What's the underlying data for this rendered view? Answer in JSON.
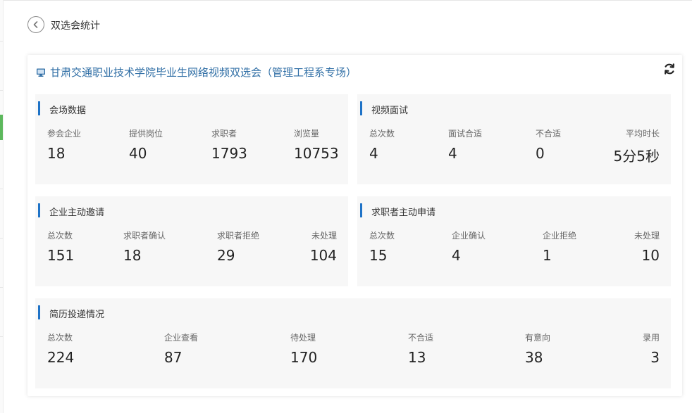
{
  "page": {
    "title": "双选会统计"
  },
  "event": {
    "title": "甘肃交通职业技术学院毕业生网络视频双选会（管理工程系专场）"
  },
  "sections": {
    "venue": {
      "title": "会场数据",
      "stats": [
        {
          "label": "参会企业",
          "value": "18"
        },
        {
          "label": "提供岗位",
          "value": "40"
        },
        {
          "label": "求职者",
          "value": "1793"
        },
        {
          "label": "浏览量",
          "value": "10753"
        }
      ]
    },
    "video": {
      "title": "视频面试",
      "stats": [
        {
          "label": "总次数",
          "value": "4"
        },
        {
          "label": "面试合适",
          "value": "4"
        },
        {
          "label": "不合适",
          "value": "0"
        },
        {
          "label": "平均时长",
          "value": "5分5秒"
        }
      ]
    },
    "invite": {
      "title": "企业主动邀请",
      "stats": [
        {
          "label": "总次数",
          "value": "151"
        },
        {
          "label": "求职者确认",
          "value": "18"
        },
        {
          "label": "求职者拒绝",
          "value": "29"
        },
        {
          "label": "未处理",
          "value": "104"
        }
      ]
    },
    "apply": {
      "title": "求职者主动申请",
      "stats": [
        {
          "label": "总次数",
          "value": "15"
        },
        {
          "label": "企业确认",
          "value": "4"
        },
        {
          "label": "企业拒绝",
          "value": "1"
        },
        {
          "label": "未处理",
          "value": "10"
        }
      ]
    },
    "resume": {
      "title": "简历投递情况",
      "stats": [
        {
          "label": "总次数",
          "value": "224"
        },
        {
          "label": "企业查看",
          "value": "87"
        },
        {
          "label": "待处理",
          "value": "170"
        },
        {
          "label": "不合适",
          "value": "13"
        },
        {
          "label": "有意向",
          "value": "38"
        },
        {
          "label": "录用",
          "value": "3"
        }
      ]
    }
  },
  "colors": {
    "accent": "#1f73c7",
    "event_title": "#2f6ea5",
    "active_nav": "#5cb85c"
  },
  "icons": {
    "back": "chevron-left-circle-icon",
    "event": "monitor-icon",
    "refresh": "refresh-icon"
  }
}
